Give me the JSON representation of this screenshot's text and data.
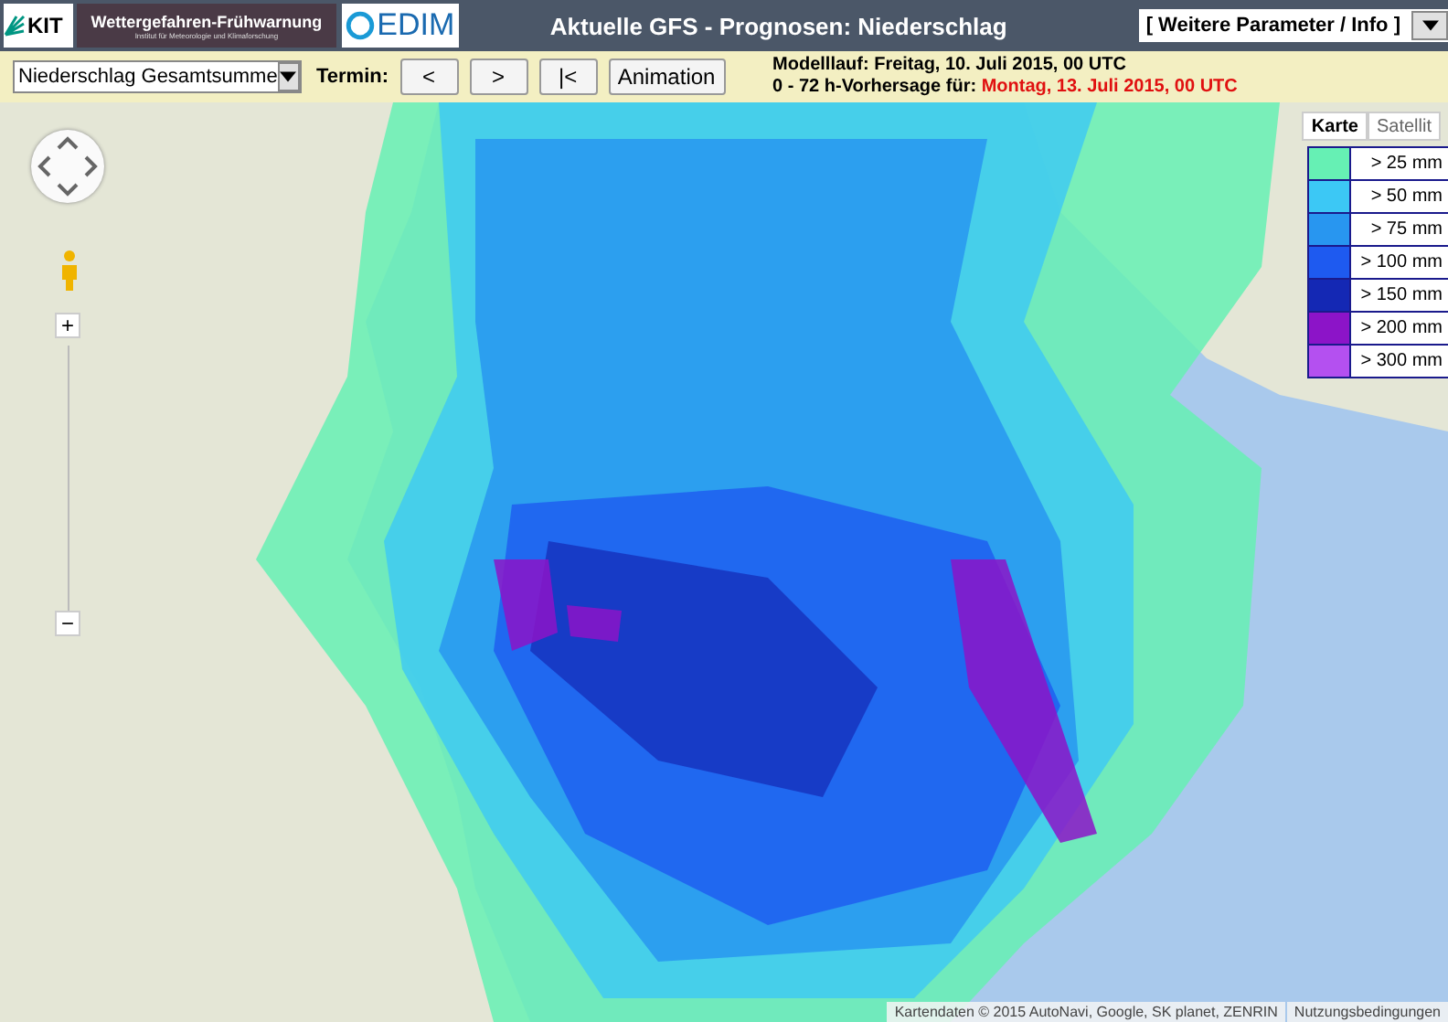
{
  "header": {
    "logos": {
      "kit": "KIT",
      "banner_title": "Wettergefahren-Frühwarnung",
      "banner_subtitle": "Institut für Meteorologie und Klimaforschung",
      "cedim": "EDIM"
    },
    "title": "Aktuelle GFS - Prognosen: Niederschlag",
    "menu": "[ Weitere Parameter / Info ]"
  },
  "toolbar": {
    "product": "Niederschlag Gesamtsumme",
    "termin_label": "Termin:",
    "buttons": [
      "<",
      ">",
      "|<",
      "Animation"
    ],
    "model_run": "Modelllauf: Freitag, 10. Juli 2015, 00 UTC",
    "forecast_label": "0 - 72 h-Vorhersage für:",
    "forecast_time": "Montag, 13. Juli 2015, 00 UTC"
  },
  "map": {
    "map_types": [
      {
        "label": "Karte",
        "selected": true
      },
      {
        "label": "Satellit",
        "selected": false
      }
    ],
    "zoom": {
      "in": "+",
      "out": "−"
    },
    "legend": [
      {
        "label": "> 25 mm",
        "color": "#66f0b4"
      },
      {
        "label": "> 50 mm",
        "color": "#3cc8f5"
      },
      {
        "label": "> 75 mm",
        "color": "#2896f0"
      },
      {
        "label": "> 100 mm",
        "color": "#1e5af0"
      },
      {
        "label": "> 150 mm",
        "color": "#1428b4"
      },
      {
        "label": "> 200 mm",
        "color": "#8c14c8"
      },
      {
        "label": "> 300 mm",
        "color": "#b450f0"
      }
    ],
    "attribution": "Kartendaten © 2015 AutoNavi, Google, SK planet, ZENRIN",
    "terms": "Nutzungsbedingungen"
  }
}
